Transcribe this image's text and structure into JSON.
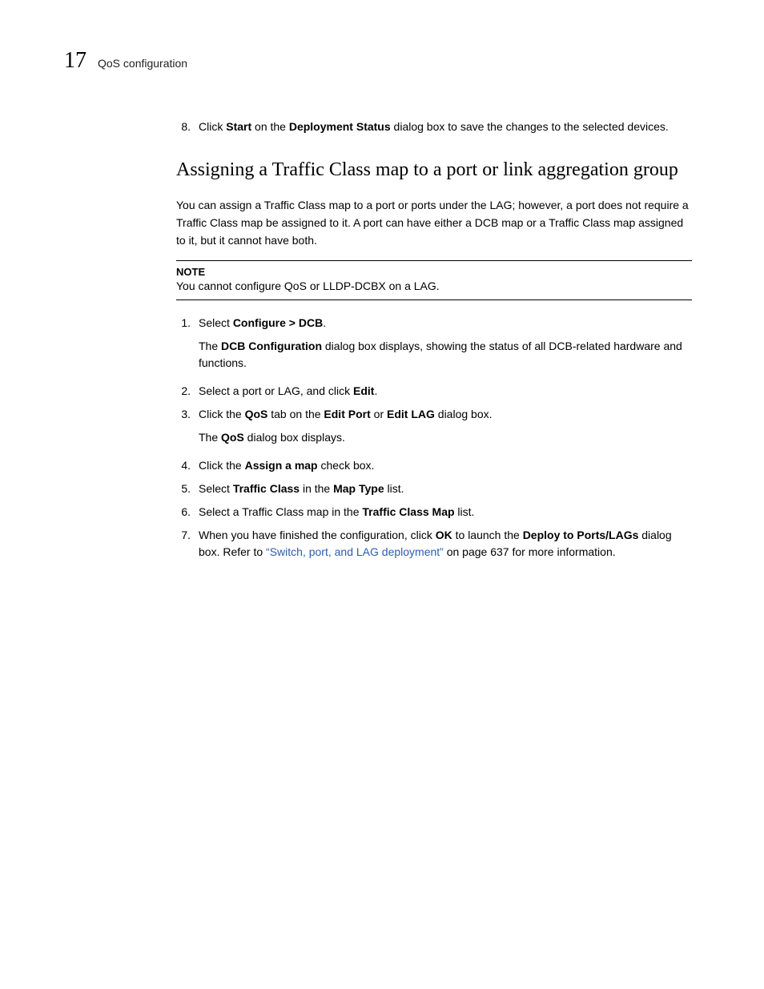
{
  "header": {
    "chapter_number": "17",
    "chapter_title": "QoS configuration"
  },
  "top_step": {
    "num": "8.",
    "pre": "Click ",
    "b1": "Start",
    "mid1": " on the ",
    "b2": "Deployment Status",
    "post": " dialog box to save the changes to the selected devices."
  },
  "heading": "Assigning a Traffic Class map to a port or link aggregation group",
  "intro": "You can assign a Traffic Class map to a port or ports under the LAG; however, a port does not require a Traffic Class map be assigned to it. A port can have either a DCB map or a Traffic Class map assigned to it, but it cannot have both.",
  "note": {
    "label": "NOTE",
    "body": "You cannot configure QoS or LLDP-DCBX on a LAG."
  },
  "steps": {
    "s1": {
      "num": "1.",
      "pre": "Select ",
      "b1": "Configure > DCB",
      "post": "."
    },
    "s1sub": {
      "pre": "The ",
      "b1": "DCB Configuration",
      "post": " dialog box displays, showing the status of all DCB-related hardware and functions."
    },
    "s2": {
      "num": "2.",
      "pre": "Select a port or LAG, and click ",
      "b1": "Edit",
      "post": "."
    },
    "s3": {
      "num": "3.",
      "pre": "Click the ",
      "b1": "QoS",
      "mid1": " tab on the ",
      "b2": "Edit Port",
      "mid2": " or ",
      "b3": "Edit LAG",
      "post": " dialog box."
    },
    "s3sub": {
      "pre": "The ",
      "b1": "QoS",
      "post": " dialog box displays."
    },
    "s4": {
      "num": "4.",
      "pre": "Click the ",
      "b1": "Assign a map",
      "post": " check box."
    },
    "s5": {
      "num": "5.",
      "pre": "Select ",
      "b1": "Traffic Class",
      "mid1": " in the ",
      "b2": "Map Type",
      "post": " list."
    },
    "s6": {
      "num": "6.",
      "pre": "Select a Traffic Class map in the ",
      "b1": "Traffic Class Map",
      "post": " list."
    },
    "s7": {
      "num": "7.",
      "pre": "When you have finished the configuration, click ",
      "b1": "OK",
      "mid1": " to launch the ",
      "b2": "Deploy to Ports/LAGs",
      "post1": " dialog box. Refer to ",
      "link": "“Switch, port, and LAG deployment”",
      "post2": " on page 637 for more information."
    }
  }
}
